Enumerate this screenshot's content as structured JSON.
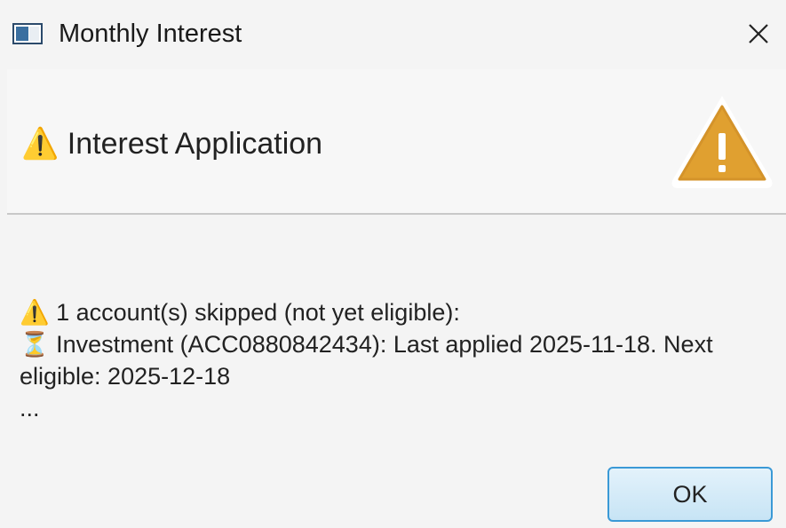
{
  "window": {
    "title": "Monthly Interest",
    "app_icon": "window-app-icon",
    "close_icon": "close-icon"
  },
  "header": {
    "text": "⚠️ Interest Application",
    "icon": "warning-triangle-icon",
    "icon_color": "#e0a030"
  },
  "content": {
    "line1": "⚠️ 1 account(s) skipped (not yet eligible):",
    "line2": "⏳ Investment (ACC0880842434): Last applied 2025-11-18. Next eligible: 2025-12-18",
    "line3": "..."
  },
  "buttons": {
    "ok_label": "OK",
    "ok_border_color": "#3a99d6"
  }
}
